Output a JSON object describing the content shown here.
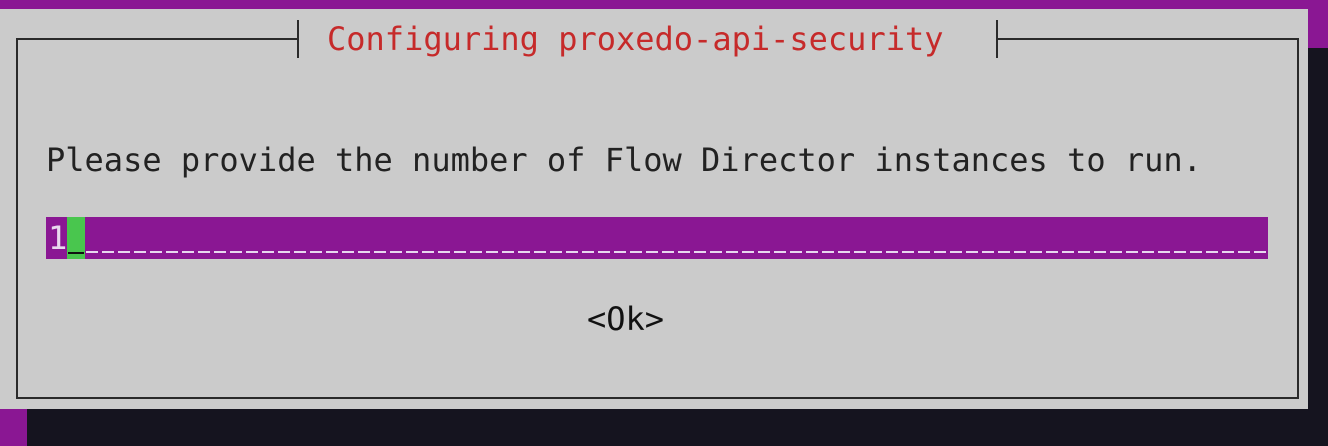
{
  "dialog": {
    "title": "Configuring proxedo-api-security",
    "prompt": "Please provide the number of Flow Director instances to run.",
    "input_value": "1",
    "ok_label": "<Ok>"
  },
  "colors": {
    "terminal_background": "#8a1793",
    "dialog_background": "#cbcbcb",
    "title_text": "#c62a2a",
    "input_background": "#8a1793",
    "cursor": "#49c64e",
    "shadow": "#15141f"
  }
}
